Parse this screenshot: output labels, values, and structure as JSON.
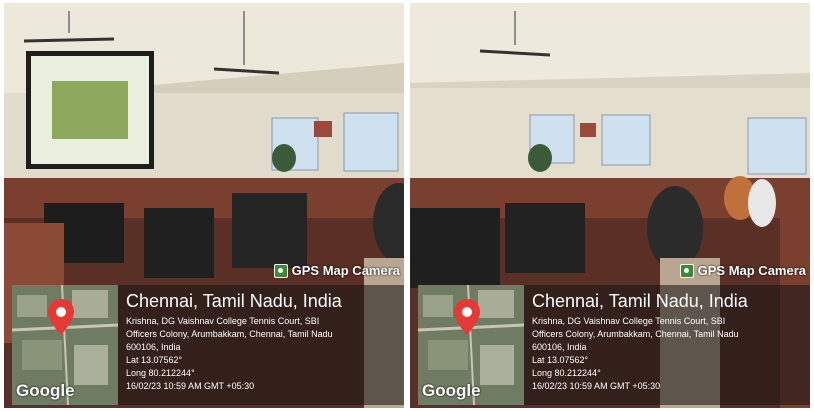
{
  "photos": [
    {
      "stamp": {
        "camera_label": "GPS Map Camera",
        "city": "Chennai, Tamil Nadu, India",
        "address_line1": "Krishna, DG Vaishnav College Tennis Court, SBI",
        "address_line2": "Officers Colony, Arumbakkam, Chennai, Tamil Nadu",
        "address_line3": "600106, India",
        "lat": "Lat 13.07562°",
        "long": "Long 80.212244°",
        "datetime": "16/02/23 10:59 AM GMT +05:30",
        "map_brand": "Google"
      }
    },
    {
      "stamp": {
        "camera_label": "GPS Map Camera",
        "city": "Chennai, Tamil Nadu, India",
        "address_line1": "Krishna, DG Vaishnav College Tennis Court, SBI",
        "address_line2": "Officers Colony, Arumbakkam, Chennai, Tamil Nadu",
        "address_line3": "600106, India",
        "lat": "Lat 13.07562°",
        "long": "Long 80.212244°",
        "datetime": "16/02/23 10:59 AM GMT +05:30",
        "map_brand": "Google"
      }
    }
  ]
}
